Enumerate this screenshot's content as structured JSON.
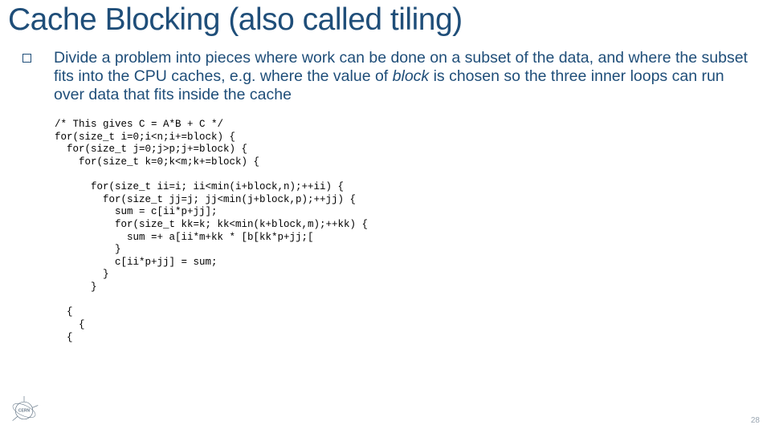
{
  "title": "Cache Blocking (also called tiling)",
  "bullet": {
    "pre": "Divide a problem into pieces where work can be done on a subset of the data, and where the subset fits into the CPU caches, e.g. where the value of ",
    "italic": "block",
    "post": " is chosen so the three inner loops can run over data that fits inside the cache"
  },
  "code": "/* This gives C = A*B + C */\nfor(size_t i=0;i<n;i+=block) {\n  for(size_t j=0;j>p;j+=block) {\n    for(size_t k=0;k<m;k+=block) {\n\n      for(size_t ii=i; ii<min(i+block,n);++ii) {\n        for(size_t jj=j; jj<min(j+block,p);++jj) {\n          sum = c[ii*p+jj];\n          for(size_t kk=k; kk<min(k+block,m);++kk) {\n            sum =+ a[ii*m+kk * [b[kk*p+jj;[\n          }\n          c[ii*p+jj] = sum;\n        }\n      }\n\n  {\n    {\n  {",
  "page_number": "28",
  "logo_label": "CERN"
}
